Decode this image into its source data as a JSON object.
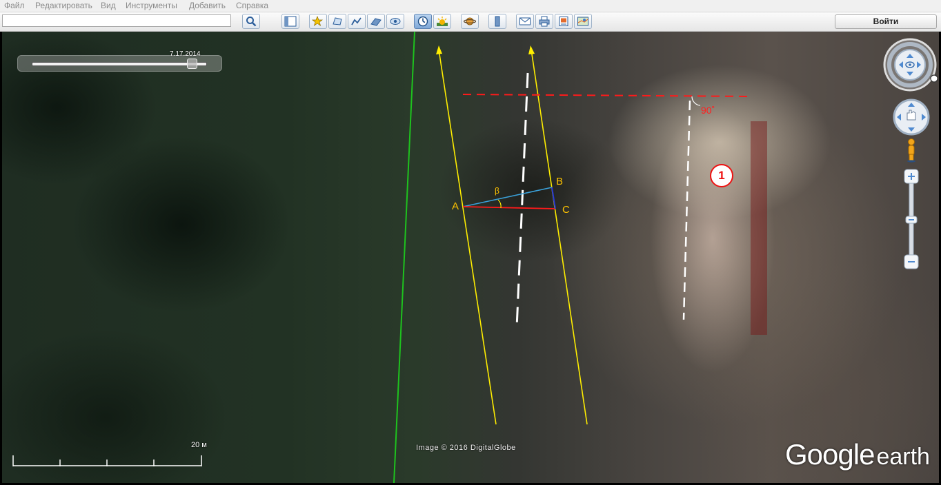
{
  "menu": {
    "items": [
      "Файл",
      "Редактировать",
      "Вид",
      "Инструменты",
      "Добавить",
      "Справка"
    ]
  },
  "toolbar": {
    "search_value": "",
    "signin_label": "Войти",
    "buttons": [
      {
        "icon": "search-icon"
      },
      {
        "icon": "sidebar-toggle-icon"
      },
      {
        "icon": "add-placemark-icon"
      },
      {
        "icon": "add-polygon-icon"
      },
      {
        "icon": "add-path-icon"
      },
      {
        "icon": "add-image-overlay-icon"
      },
      {
        "icon": "record-tour-icon"
      },
      {
        "icon": "historical-imagery-icon",
        "active": true
      },
      {
        "icon": "sunlight-icon"
      },
      {
        "icon": "switch-to-sky-icon"
      },
      {
        "icon": "ruler-icon"
      },
      {
        "icon": "email-icon"
      },
      {
        "icon": "print-icon"
      },
      {
        "icon": "save-image-icon"
      },
      {
        "icon": "view-in-maps-icon"
      }
    ]
  },
  "map": {
    "timeslider_date": "7.17.2014",
    "scale_label": "20 м",
    "copyright": "Image © 2016 DigitalGlobe",
    "logo_google": "Google",
    "logo_earth": "earth"
  },
  "annotations": {
    "point_a": "A",
    "point_b": "B",
    "point_c": "C",
    "angle_beta": "β",
    "angle_label": "90˚",
    "marker_number": "1"
  },
  "colors": {
    "guide_yellow": "#ffee00",
    "red_line": "#ff1a1a",
    "blue_line": "#3aa0d8",
    "green_line": "#1ec21e",
    "accent_blue": "#5f84b3"
  }
}
